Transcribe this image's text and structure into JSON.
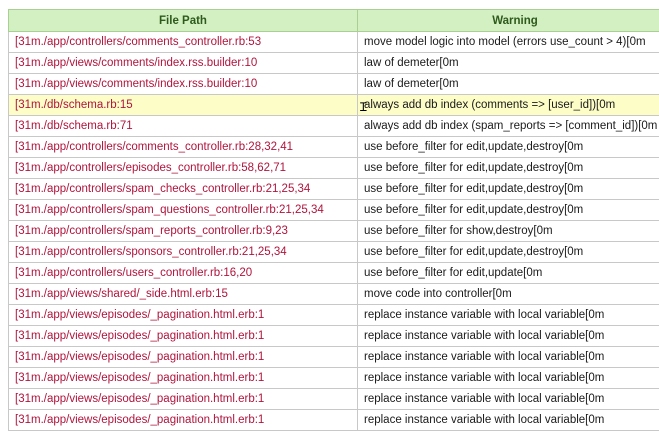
{
  "table": {
    "headers": {
      "file_path": "File Path",
      "warning": "Warning"
    },
    "highlighted_row": 3,
    "rows": [
      {
        "path": "[31m./app/controllers/comments_controller.rb:53",
        "warning": "move model logic into model (errors use_count > 4)[0m"
      },
      {
        "path": "[31m./app/views/comments/index.rss.builder:10",
        "warning": "law of demeter[0m"
      },
      {
        "path": "[31m./app/views/comments/index.rss.builder:10",
        "warning": "law of demeter[0m"
      },
      {
        "path": "[31m./db/schema.rb:15",
        "warning": "always add db index (comments => [user_id])[0m"
      },
      {
        "path": "[31m./db/schema.rb:71",
        "warning": "always add db index (spam_reports => [comment_id])[0m"
      },
      {
        "path": "[31m./app/controllers/comments_controller.rb:28,32,41",
        "warning": "use before_filter for edit,update,destroy[0m"
      },
      {
        "path": "[31m./app/controllers/episodes_controller.rb:58,62,71",
        "warning": "use before_filter for edit,update,destroy[0m"
      },
      {
        "path": "[31m./app/controllers/spam_checks_controller.rb:21,25,34",
        "warning": "use before_filter for edit,update,destroy[0m"
      },
      {
        "path": "[31m./app/controllers/spam_questions_controller.rb:21,25,34",
        "warning": "use before_filter for edit,update,destroy[0m"
      },
      {
        "path": "[31m./app/controllers/spam_reports_controller.rb:9,23",
        "warning": "use before_filter for show,destroy[0m"
      },
      {
        "path": "[31m./app/controllers/sponsors_controller.rb:21,25,34",
        "warning": "use before_filter for edit,update,destroy[0m"
      },
      {
        "path": "[31m./app/controllers/users_controller.rb:16,20",
        "warning": "use before_filter for edit,update[0m"
      },
      {
        "path": "[31m./app/views/shared/_side.html.erb:15",
        "warning": "move code into controller[0m"
      },
      {
        "path": "[31m./app/views/episodes/_pagination.html.erb:1",
        "warning": "replace instance variable with local variable[0m"
      },
      {
        "path": "[31m./app/views/episodes/_pagination.html.erb:1",
        "warning": "replace instance variable with local variable[0m"
      },
      {
        "path": "[31m./app/views/episodes/_pagination.html.erb:1",
        "warning": "replace instance variable with local variable[0m"
      },
      {
        "path": "[31m./app/views/episodes/_pagination.html.erb:1",
        "warning": "replace instance variable with local variable[0m"
      },
      {
        "path": "[31m./app/views/episodes/_pagination.html.erb:1",
        "warning": "replace instance variable with local variable[0m"
      },
      {
        "path": "[31m./app/views/episodes/_pagination.html.erb:1",
        "warning": "replace instance variable with local variable[0m"
      }
    ]
  },
  "colors": {
    "header_bg": "#d3f0c3",
    "path_text": "#b0143c",
    "highlight_bg": "#fdfdc8"
  }
}
